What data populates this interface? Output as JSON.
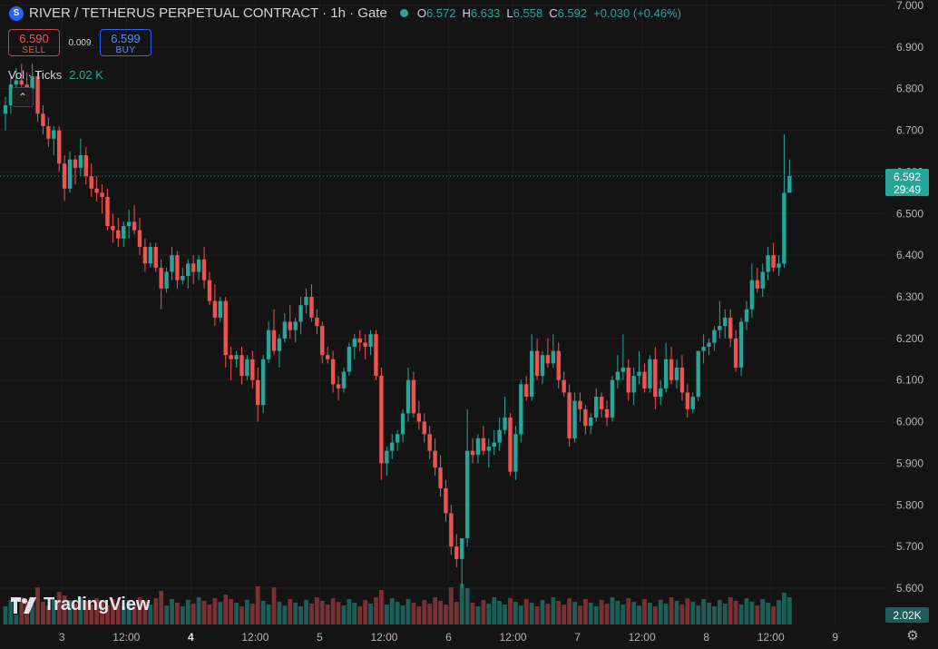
{
  "header": {
    "symbol_icon": "S",
    "title": "RIVER / TETHERUS PERPETUAL CONTRACT · 1h · Gate",
    "ohlc": [
      {
        "k": "O",
        "v": "6.572"
      },
      {
        "k": "H",
        "v": "6.633"
      },
      {
        "k": "L",
        "v": "6.558"
      },
      {
        "k": "C",
        "v": "6.592"
      },
      {
        "k": "",
        "v": "+0.030 (+0.46%)"
      }
    ]
  },
  "trade": {
    "sell_price": "6.590",
    "sell_label": "SELL",
    "spread": "0.009",
    "buy_price": "6.599",
    "buy_label": "BUY"
  },
  "volume_indicator": {
    "label": "Vol · Ticks",
    "value": "2.02 K"
  },
  "logo_text": "TradingView",
  "price_label": {
    "price": "6.592",
    "countdown": "29:49"
  },
  "volume_label": "2.02K",
  "colors": {
    "up": "#26a69a",
    "down": "#ef5350",
    "up_vol": "#1e5e58",
    "down_vol": "#7a2f33",
    "background": "#141414",
    "grid": "#1f1f1f"
  },
  "chart_data": {
    "type": "candlestick",
    "y_ticks": [
      "7.000",
      "6.900",
      "6.800",
      "6.700",
      "6.600",
      "6.500",
      "6.400",
      "6.300",
      "6.200",
      "6.100",
      "6.000",
      "5.900",
      "5.800",
      "5.700",
      "5.600"
    ],
    "ylim": [
      5.52,
      7.0
    ],
    "x_ticks": [
      {
        "label": "3",
        "index": 9,
        "bold": false
      },
      {
        "label": "12:00",
        "index": 21,
        "bold": false
      },
      {
        "label": "4",
        "index": 33,
        "bold": true
      },
      {
        "label": "12:00",
        "index": 45,
        "bold": false
      },
      {
        "label": "5",
        "index": 57,
        "bold": false
      },
      {
        "label": "12:00",
        "index": 69,
        "bold": false
      },
      {
        "label": "6",
        "index": 81,
        "bold": false
      },
      {
        "label": "12:00",
        "index": 93,
        "bold": false
      },
      {
        "label": "7",
        "index": 105,
        "bold": false
      },
      {
        "label": "12:00",
        "index": 117,
        "bold": false
      },
      {
        "label": "8",
        "index": 129,
        "bold": false
      },
      {
        "label": "12:00",
        "index": 141,
        "bold": false
      },
      {
        "label": "9",
        "index": 153,
        "bold": false
      }
    ],
    "candles": [
      [
        6.74,
        6.78,
        6.7,
        6.76,
        1
      ],
      [
        6.76,
        6.83,
        6.74,
        6.81,
        1
      ],
      [
        6.81,
        6.85,
        6.79,
        6.82,
        0
      ],
      [
        6.82,
        6.86,
        6.79,
        6.81,
        1
      ],
      [
        6.81,
        6.84,
        6.78,
        6.8,
        1
      ],
      [
        6.8,
        6.86,
        6.77,
        6.83,
        1
      ],
      [
        6.83,
        6.84,
        6.72,
        6.74,
        2
      ],
      [
        6.74,
        6.76,
        6.69,
        6.71,
        1
      ],
      [
        6.71,
        6.73,
        6.66,
        6.68,
        1
      ],
      [
        6.68,
        6.71,
        6.64,
        6.7,
        1
      ],
      [
        6.7,
        6.71,
        6.6,
        6.62,
        2
      ],
      [
        6.62,
        6.64,
        6.53,
        6.56,
        2
      ],
      [
        6.56,
        6.65,
        6.55,
        6.63,
        1
      ],
      [
        6.63,
        6.64,
        6.57,
        6.61,
        1
      ],
      [
        6.61,
        6.68,
        6.59,
        6.64,
        1
      ],
      [
        6.64,
        6.66,
        6.57,
        6.59,
        1
      ],
      [
        6.59,
        6.62,
        6.54,
        6.56,
        1
      ],
      [
        6.56,
        6.59,
        6.53,
        6.55,
        1
      ],
      [
        6.55,
        6.57,
        6.5,
        6.54,
        1
      ],
      [
        6.54,
        6.56,
        6.46,
        6.47,
        1
      ],
      [
        6.47,
        6.5,
        6.43,
        6.46,
        1
      ],
      [
        6.46,
        6.49,
        6.42,
        6.44,
        1
      ],
      [
        6.44,
        6.48,
        6.42,
        6.47,
        1
      ],
      [
        6.47,
        6.51,
        6.44,
        6.48,
        1
      ],
      [
        6.48,
        6.52,
        6.45,
        6.46,
        1
      ],
      [
        6.46,
        6.49,
        6.4,
        6.42,
        1
      ],
      [
        6.42,
        6.44,
        6.36,
        6.38,
        1
      ],
      [
        6.38,
        6.43,
        6.37,
        6.42,
        1
      ],
      [
        6.42,
        6.43,
        6.36,
        6.37,
        1
      ],
      [
        6.37,
        6.39,
        6.27,
        6.32,
        2
      ],
      [
        6.32,
        6.37,
        6.31,
        6.36,
        1
      ],
      [
        6.36,
        6.42,
        6.34,
        6.4,
        1
      ],
      [
        6.4,
        6.41,
        6.32,
        6.34,
        1
      ],
      [
        6.34,
        6.37,
        6.33,
        6.35,
        1
      ],
      [
        6.35,
        6.39,
        6.32,
        6.38,
        1
      ],
      [
        6.38,
        6.4,
        6.33,
        6.36,
        1
      ],
      [
        6.36,
        6.4,
        6.34,
        6.39,
        1
      ],
      [
        6.39,
        6.42,
        6.32,
        6.34,
        1
      ],
      [
        6.34,
        6.36,
        6.28,
        6.29,
        1
      ],
      [
        6.29,
        6.33,
        6.23,
        6.25,
        1
      ],
      [
        6.25,
        6.3,
        6.24,
        6.29,
        1
      ],
      [
        6.29,
        6.3,
        6.13,
        6.16,
        2
      ],
      [
        6.16,
        6.18,
        6.1,
        6.15,
        1
      ],
      [
        6.15,
        6.17,
        6.13,
        6.16,
        1
      ],
      [
        6.16,
        6.18,
        6.09,
        6.11,
        1
      ],
      [
        6.11,
        6.16,
        6.1,
        6.15,
        1
      ],
      [
        6.15,
        6.17,
        6.08,
        6.1,
        1
      ],
      [
        6.1,
        6.13,
        6.0,
        6.04,
        2
      ],
      [
        6.04,
        6.16,
        6.02,
        6.15,
        1
      ],
      [
        6.15,
        6.24,
        6.14,
        6.22,
        1
      ],
      [
        6.22,
        6.27,
        6.16,
        6.17,
        2
      ],
      [
        6.17,
        6.21,
        6.13,
        6.2,
        1
      ],
      [
        6.2,
        6.26,
        6.19,
        6.24,
        1
      ],
      [
        6.24,
        6.28,
        6.2,
        6.22,
        1
      ],
      [
        6.22,
        6.25,
        6.19,
        6.24,
        1
      ],
      [
        6.24,
        6.3,
        6.21,
        6.28,
        1
      ],
      [
        6.28,
        6.32,
        6.26,
        6.3,
        1
      ],
      [
        6.3,
        6.33,
        6.24,
        6.25,
        1
      ],
      [
        6.25,
        6.27,
        6.21,
        6.23,
        1
      ],
      [
        6.23,
        6.24,
        6.14,
        6.16,
        1
      ],
      [
        6.16,
        6.18,
        6.14,
        6.15,
        1
      ],
      [
        6.15,
        6.17,
        6.07,
        6.09,
        1
      ],
      [
        6.09,
        6.11,
        6.05,
        6.08,
        1
      ],
      [
        6.08,
        6.13,
        6.07,
        6.12,
        1
      ],
      [
        6.12,
        6.19,
        6.11,
        6.18,
        1
      ],
      [
        6.18,
        6.21,
        6.15,
        6.2,
        1
      ],
      [
        6.2,
        6.22,
        6.17,
        6.19,
        1
      ],
      [
        6.19,
        6.21,
        6.15,
        6.18,
        1
      ],
      [
        6.18,
        6.22,
        6.16,
        6.21,
        1
      ],
      [
        6.21,
        6.22,
        6.1,
        6.11,
        1
      ],
      [
        6.11,
        6.13,
        5.86,
        5.9,
        2
      ],
      [
        5.9,
        5.94,
        5.87,
        5.93,
        1
      ],
      [
        5.93,
        5.97,
        5.91,
        5.95,
        1
      ],
      [
        5.95,
        5.98,
        5.93,
        5.97,
        1
      ],
      [
        5.97,
        6.03,
        5.95,
        6.02,
        1
      ],
      [
        6.02,
        6.13,
        6.0,
        6.1,
        1
      ],
      [
        6.1,
        6.12,
        6.01,
        6.02,
        1
      ],
      [
        6.02,
        6.05,
        5.98,
        6.0,
        1
      ],
      [
        6.0,
        6.02,
        5.95,
        5.97,
        1
      ],
      [
        5.97,
        5.99,
        5.91,
        5.93,
        1
      ],
      [
        5.93,
        5.96,
        5.87,
        5.89,
        1
      ],
      [
        5.89,
        5.92,
        5.82,
        5.84,
        1
      ],
      [
        5.84,
        5.86,
        5.76,
        5.78,
        1
      ],
      [
        5.78,
        5.8,
        5.68,
        5.7,
        2
      ],
      [
        5.7,
        5.73,
        5.65,
        5.67,
        1
      ],
      [
        5.67,
        5.72,
        5.6,
        5.72,
        3
      ],
      [
        5.72,
        6.03,
        5.7,
        5.93,
        2
      ],
      [
        5.93,
        5.96,
        5.9,
        5.92,
        1
      ],
      [
        5.92,
        5.97,
        5.9,
        5.96,
        1
      ],
      [
        5.96,
        5.99,
        5.92,
        5.93,
        1
      ],
      [
        5.93,
        5.96,
        5.89,
        5.94,
        1
      ],
      [
        5.94,
        5.98,
        5.92,
        5.95,
        1
      ],
      [
        5.95,
        6.01,
        5.93,
        5.98,
        1
      ],
      [
        5.98,
        6.06,
        5.97,
        6.01,
        1
      ],
      [
        6.01,
        6.02,
        5.87,
        5.88,
        1
      ],
      [
        5.88,
        5.99,
        5.86,
        5.97,
        1
      ],
      [
        5.97,
        6.1,
        5.95,
        6.09,
        1
      ],
      [
        6.09,
        6.11,
        6.05,
        6.06,
        1
      ],
      [
        6.06,
        6.21,
        6.05,
        6.17,
        1
      ],
      [
        6.17,
        6.2,
        6.1,
        6.11,
        1
      ],
      [
        6.11,
        6.17,
        6.09,
        6.16,
        1
      ],
      [
        6.16,
        6.2,
        6.13,
        6.14,
        1
      ],
      [
        6.14,
        6.21,
        6.13,
        6.17,
        1
      ],
      [
        6.17,
        6.19,
        6.08,
        6.1,
        1
      ],
      [
        6.1,
        6.12,
        6.06,
        6.07,
        1
      ],
      [
        6.07,
        6.09,
        5.94,
        5.96,
        1
      ],
      [
        5.96,
        6.07,
        5.95,
        6.05,
        1
      ],
      [
        6.05,
        6.07,
        6.0,
        6.03,
        1
      ],
      [
        6.03,
        6.04,
        5.97,
        5.99,
        1
      ],
      [
        5.99,
        6.02,
        5.97,
        6.01,
        1
      ],
      [
        6.01,
        6.08,
        6.0,
        6.06,
        1
      ],
      [
        6.06,
        6.07,
        6.01,
        6.03,
        1
      ],
      [
        6.03,
        6.05,
        5.99,
        6.01,
        1
      ],
      [
        6.01,
        6.11,
        6.0,
        6.1,
        1
      ],
      [
        6.1,
        6.16,
        6.08,
        6.12,
        1
      ],
      [
        6.12,
        6.21,
        6.1,
        6.13,
        1
      ],
      [
        6.13,
        6.15,
        6.05,
        6.07,
        1
      ],
      [
        6.07,
        6.13,
        6.04,
        6.11,
        1
      ],
      [
        6.11,
        6.17,
        6.09,
        6.12,
        1
      ],
      [
        6.12,
        6.14,
        6.07,
        6.08,
        1
      ],
      [
        6.08,
        6.16,
        6.07,
        6.15,
        1
      ],
      [
        6.15,
        6.18,
        6.03,
        6.06,
        1
      ],
      [
        6.06,
        6.1,
        6.04,
        6.08,
        1
      ],
      [
        6.08,
        6.19,
        6.07,
        6.15,
        1
      ],
      [
        6.15,
        6.18,
        6.09,
        6.1,
        1
      ],
      [
        6.1,
        6.15,
        6.08,
        6.13,
        1
      ],
      [
        6.13,
        6.16,
        6.05,
        6.07,
        1
      ],
      [
        6.07,
        6.09,
        6.01,
        6.03,
        1
      ],
      [
        6.03,
        6.07,
        6.02,
        6.06,
        1
      ],
      [
        6.06,
        6.17,
        6.05,
        6.17,
        1
      ],
      [
        6.17,
        6.21,
        6.14,
        6.18,
        1
      ],
      [
        6.18,
        6.2,
        6.16,
        6.19,
        1
      ],
      [
        6.19,
        6.23,
        6.17,
        6.22,
        1
      ],
      [
        6.22,
        6.29,
        6.2,
        6.23,
        1
      ],
      [
        6.23,
        6.27,
        6.2,
        6.25,
        1
      ],
      [
        6.25,
        6.27,
        6.18,
        6.2,
        1
      ],
      [
        6.2,
        6.22,
        6.12,
        6.13,
        1
      ],
      [
        6.13,
        6.25,
        6.11,
        6.24,
        1
      ],
      [
        6.24,
        6.29,
        6.22,
        6.27,
        1
      ],
      [
        6.27,
        6.38,
        6.25,
        6.34,
        1
      ],
      [
        6.34,
        6.37,
        6.31,
        6.32,
        1
      ],
      [
        6.32,
        6.38,
        6.3,
        6.36,
        1
      ],
      [
        6.36,
        6.42,
        6.34,
        6.4,
        1
      ],
      [
        6.4,
        6.43,
        6.36,
        6.37,
        1
      ],
      [
        6.37,
        6.4,
        6.35,
        6.38,
        1
      ],
      [
        6.38,
        6.69,
        6.37,
        6.55,
        2
      ],
      [
        6.55,
        6.63,
        6.55,
        6.59,
        1
      ]
    ]
  }
}
